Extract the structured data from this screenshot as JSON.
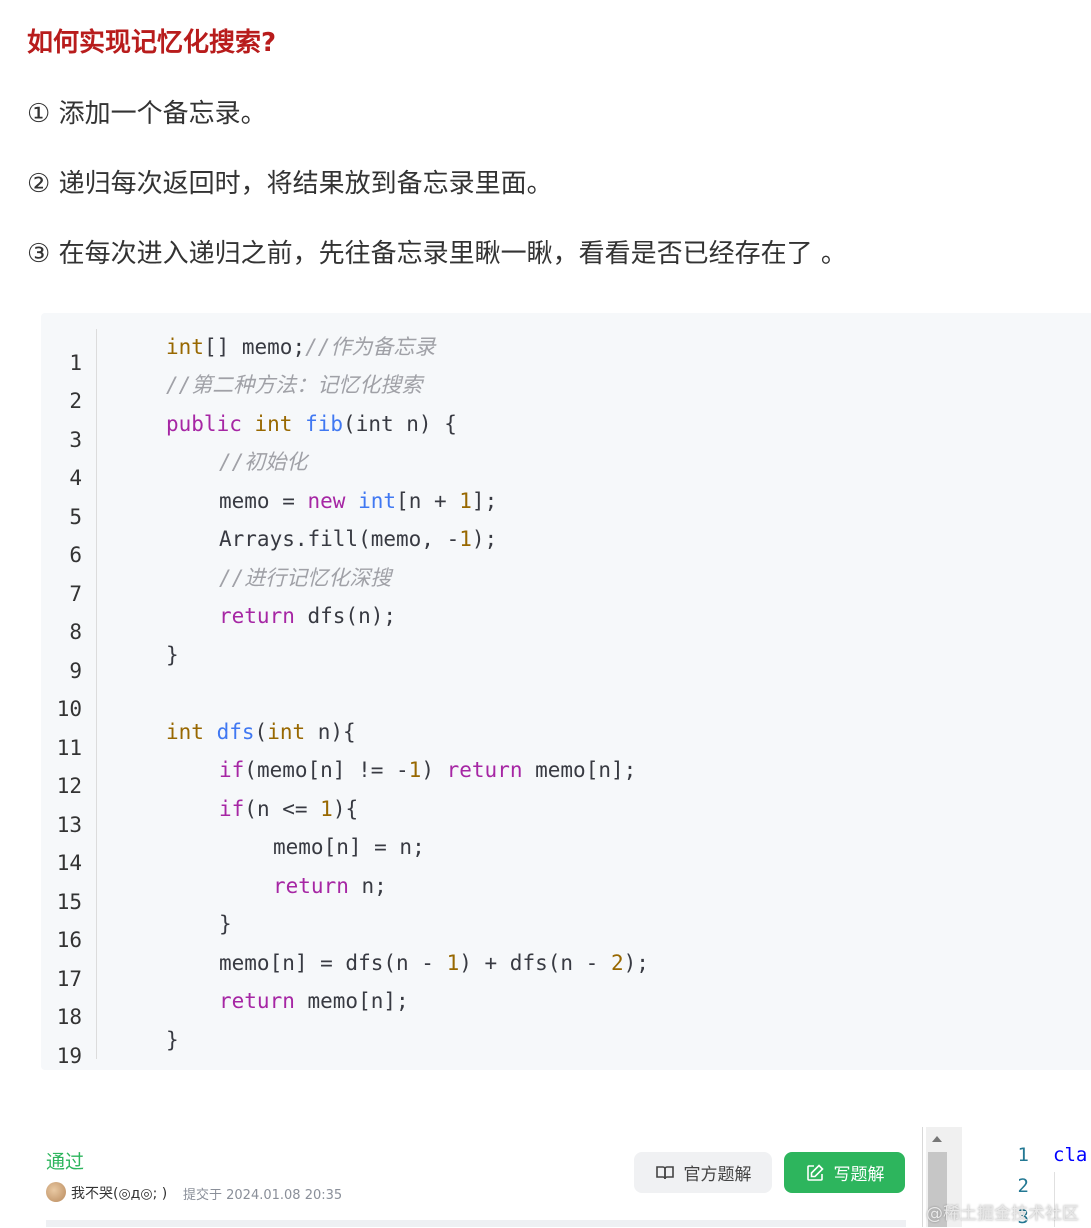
{
  "article": {
    "heading": "如何实现记忆化搜索?",
    "steps": [
      "① 添加一个备忘录。",
      "② 递归每次返回时，将结果放到备忘录里面。",
      "③ 在每次进入递归之前，先往备忘录里瞅一瞅，看看是否已经存在了 。"
    ]
  },
  "code_block": {
    "line_numbers": [
      "1",
      "2",
      "3",
      "4",
      "5",
      "6",
      "7",
      "8",
      "9",
      "10",
      "11",
      "12",
      "13",
      "14",
      "15",
      "16",
      "17",
      "18",
      "19"
    ],
    "t": {
      "int": "int",
      "memo": " memo",
      "memo_arr": "memo[n]",
      "lines": {
        "l1_a": "[] memo;",
        "l1_c": "//作为备忘录",
        "l2_c": "//第二种方法：记忆化搜索",
        "l3_public": "public",
        "l3_fib": "fib",
        "l3_rest": "(int n) {",
        "l4_c": "//初始化",
        "l5_a": "memo = ",
        "l5_new": "new",
        "l5_b": "[n + ",
        "l5_num": "1",
        "l5_c": "];",
        "l6_a": "Arrays.fill(memo, -",
        "l6_num": "1",
        "l6_c": ");",
        "l7_c": "//进行记忆化深搜",
        "l8_ret": "return",
        "l8_rest": " dfs(n);",
        "close": "}",
        "l11_dfs": "dfs",
        "l11_a": "(",
        "l11_int": "int",
        "l11_b": " n){",
        "l12_if": "if",
        "l12_a": "(memo[n] != -",
        "l12_num": "1",
        "l12_b": ") ",
        "l12_ret": "return",
        "l12_c": " memo[n];",
        "l13_if": "if",
        "l13_a": "(n <= ",
        "l13_num": "1",
        "l13_b": "){",
        "l14": "memo[n] = n;",
        "l15_ret": "return",
        "l15_rest": " n;",
        "l17_a": "memo[n] = dfs(n - ",
        "l17_n1": "1",
        "l17_b": ") + dfs(n - ",
        "l17_n2": "2",
        "l17_c": ");",
        "l18_ret": "return",
        "l18_rest": " memo[n];"
      }
    }
  },
  "submission": {
    "status": "通过",
    "author": "我不哭(◎д◎; )",
    "submitted_text": "提交于 2024.01.08 20:35",
    "official_solution_label": "官方题解",
    "write_solution_label": "写题解",
    "icons": [
      "book-icon",
      "edit-icon",
      "avatar"
    ],
    "colors": {
      "pass": "#2db55d",
      "heading": "#b81c1c"
    }
  },
  "editor": {
    "line_numbers": [
      "1",
      "2",
      "3"
    ],
    "code_start": "cla"
  },
  "watermark": "@稀土掘金技术社区"
}
